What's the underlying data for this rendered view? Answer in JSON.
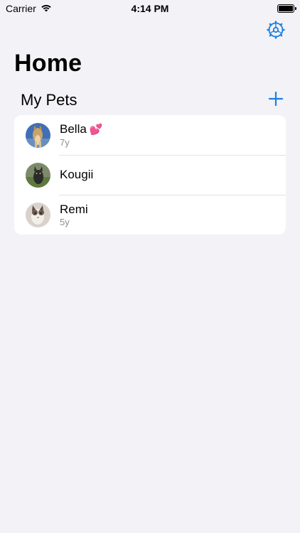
{
  "status_bar": {
    "carrier": "Carrier",
    "time": "4:14 PM"
  },
  "header": {
    "title": "Home",
    "settings_icon": "gear-icon"
  },
  "section": {
    "title": "My Pets",
    "add_icon": "plus-icon"
  },
  "pets": [
    {
      "name": "Bella",
      "emoji": "💕",
      "age": "7y"
    },
    {
      "name": "Kougii",
      "emoji": "",
      "age": ""
    },
    {
      "name": "Remi",
      "emoji": "",
      "age": "5y"
    }
  ],
  "colors": {
    "accent": "#1a7fe0",
    "background": "#f2f2f7",
    "secondary_text": "#8e8e93"
  }
}
